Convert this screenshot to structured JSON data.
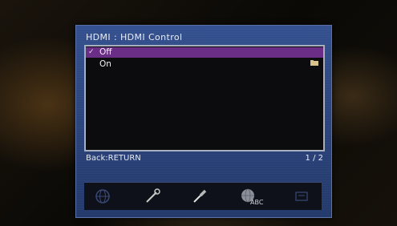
{
  "screen": {
    "title": "HDMI : HDMI Control",
    "options": [
      {
        "label": "Off",
        "check": "✓",
        "selected": true
      },
      {
        "label": "On",
        "icon": "folder-icon"
      }
    ],
    "back_hint": "Back:RETURN",
    "page_indicator": "1 / 2",
    "icon_bar": [
      {
        "name": "globe-icon"
      },
      {
        "name": "wrench-icon"
      },
      {
        "name": "screwdriver-icon"
      },
      {
        "name": "language-icon",
        "text": "ABC"
      },
      {
        "name": "misc-icon"
      }
    ]
  },
  "colors": {
    "panel": "#2d4680",
    "selection": "#6a2e86",
    "list_background": "#0c0c0e"
  }
}
